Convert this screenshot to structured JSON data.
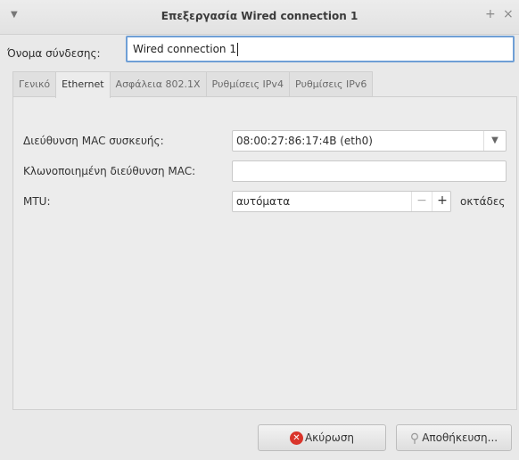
{
  "window": {
    "title": "Επεξεργασία Wired connection 1",
    "menu_icon": "chevron-down-icon",
    "plus_glyph": "+",
    "close_glyph": "×"
  },
  "connection": {
    "name_label": "Όνομα σύνδεσης:",
    "name_value": "Wired connection 1"
  },
  "tabs": [
    {
      "label": "Γενικό",
      "active": false
    },
    {
      "label": "Ethernet",
      "active": true
    },
    {
      "label": "Ασφάλεια 802.1X",
      "active": false
    },
    {
      "label": "Ρυθμίσεις IPv4",
      "active": false
    },
    {
      "label": "Ρυθμίσεις IPv6",
      "active": false
    }
  ],
  "ethernet": {
    "device_mac_label": "Διεύθυνση MAC συσκευής:",
    "device_mac_value": "08:00:27:86:17:4B (eth0)",
    "cloned_mac_label": "Κλωνοποιημένη διεύθυνση MAC:",
    "cloned_mac_value": "",
    "mtu_label": "MTU:",
    "mtu_value": "αυτόματα",
    "mtu_unit": "οκτάδες",
    "minus_glyph": "−",
    "plus_glyph": "+"
  },
  "buttons": {
    "cancel_label": "Ακύρωση",
    "save_label": "Αποθήκευση..."
  }
}
